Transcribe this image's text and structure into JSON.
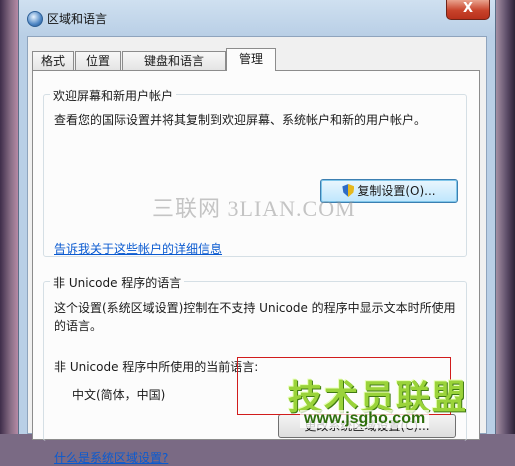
{
  "window": {
    "title": "区域和语言",
    "close_label": "X"
  },
  "tabs": [
    {
      "label": "格式"
    },
    {
      "label": "位置"
    },
    {
      "label": "键盘和语言"
    },
    {
      "label": "管理"
    }
  ],
  "active_tab": "管理",
  "welcome_group": {
    "title": "欢迎屏幕和新用户帐户",
    "description": "查看您的国际设置并将其复制到欢迎屏幕、系统帐户和新的用户帐户。",
    "copy_button_label": "复制设置(O)...",
    "copy_button_icon": "uac-shield-icon",
    "link": "告诉我关于这些帐户的详细信息"
  },
  "unicode_group": {
    "title": "非 Unicode 程序的语言",
    "description": "这个设置(系统区域设置)控制在不支持 Unicode 的程序中显示文本时所使用的语言。",
    "current_label": "非 Unicode 程序中所使用的当前语言:",
    "current_value": "中文(简体，中国)",
    "change_button_label": "更改系统区域设置(C)...",
    "link": "什么是系统区域设置?"
  },
  "watermarks": {
    "text1": "三联网 3LIAN.COM",
    "logo_text": "技术员联盟",
    "logo_url": "www.jsgho.com"
  },
  "colors": {
    "highlight_rect": "#d11c1c",
    "link": "#0a5ad0",
    "close_button": "#c8432b"
  }
}
